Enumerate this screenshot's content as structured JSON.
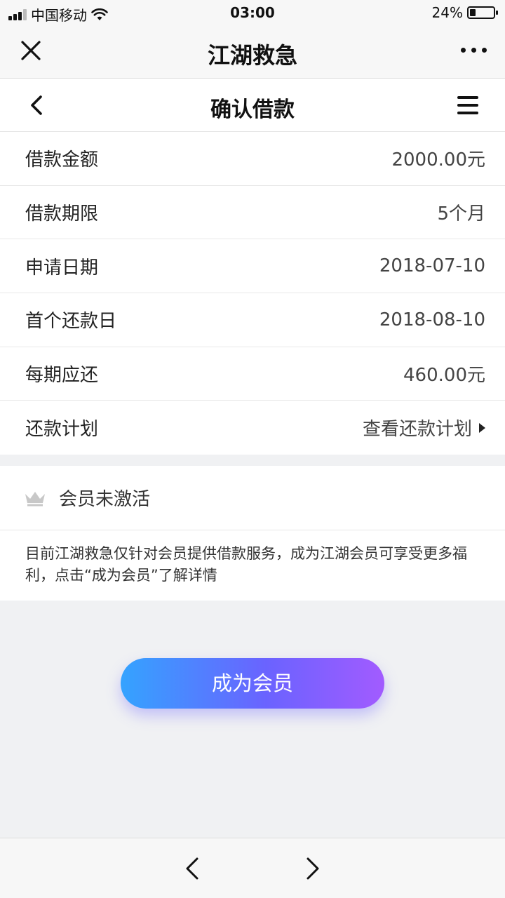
{
  "status_bar": {
    "carrier": "中国移动",
    "time": "03:00",
    "battery_text": "24%",
    "battery_level": 0.24
  },
  "app_bar": {
    "title": "江湖救急"
  },
  "nav_bar": {
    "title": "确认借款"
  },
  "loan_rows": [
    {
      "label": "借款金额",
      "value": "2000.00元"
    },
    {
      "label": "借款期限",
      "value": "5个月"
    },
    {
      "label": "申请日期",
      "value": "2018-07-10"
    },
    {
      "label": "首个还款日",
      "value": "2018-08-10"
    },
    {
      "label": "每期应还",
      "value": "460.00元"
    },
    {
      "label": "还款计划",
      "value": "查看还款计划"
    }
  ],
  "member": {
    "status": "会员未激活",
    "description": "目前江湖救急仅针对会员提供借款服务，成为江湖会员可享受更多福利，点击“成为会员”了解详情"
  },
  "cta": {
    "label": "成为会员"
  },
  "colors": {
    "cta_gradient_start": "#34a3ff",
    "cta_gradient_end": "#a25bff",
    "crown": "#c8c8c8"
  },
  "icons": [
    "close-icon",
    "more-icon",
    "back-icon",
    "menu-icon",
    "chevron-right-icon",
    "crown-icon",
    "nav-back-icon",
    "nav-forward-icon"
  ]
}
